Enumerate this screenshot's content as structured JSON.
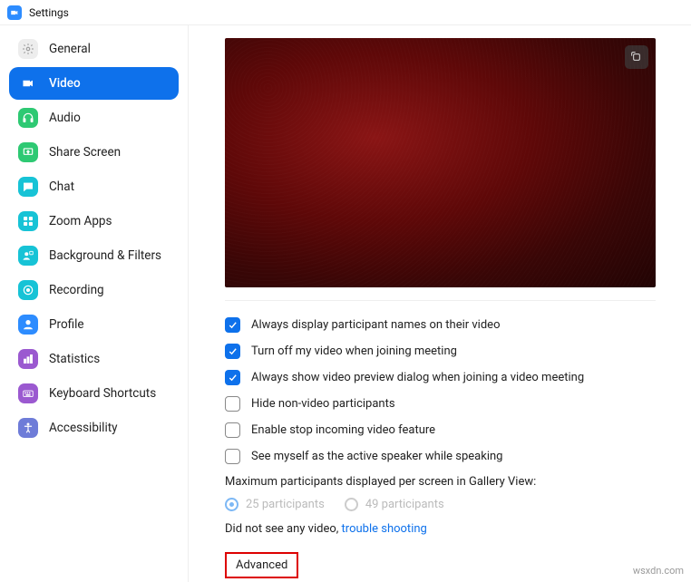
{
  "title": "Settings",
  "sidebar": {
    "items": [
      {
        "label": "General",
        "icon": "gear",
        "bg": "#ededed",
        "fg": "#9e9e9e",
        "active": false
      },
      {
        "label": "Video",
        "icon": "video",
        "bg": "#ffffff",
        "fg": "#ffffff",
        "active": true
      },
      {
        "label": "Audio",
        "icon": "headphones",
        "bg": "#2ec973",
        "fg": "#ffffff",
        "active": false
      },
      {
        "label": "Share Screen",
        "icon": "share",
        "bg": "#2ec973",
        "fg": "#ffffff",
        "active": false
      },
      {
        "label": "Chat",
        "icon": "chat",
        "bg": "#17c3d6",
        "fg": "#ffffff",
        "active": false
      },
      {
        "label": "Zoom Apps",
        "icon": "apps",
        "bg": "#17c3d6",
        "fg": "#ffffff",
        "active": false
      },
      {
        "label": "Background & Filters",
        "icon": "bg",
        "bg": "#17c3d6",
        "fg": "#ffffff",
        "active": false
      },
      {
        "label": "Recording",
        "icon": "record",
        "bg": "#17c3d6",
        "fg": "#ffffff",
        "active": false
      },
      {
        "label": "Profile",
        "icon": "profile",
        "bg": "#2D8CFF",
        "fg": "#ffffff",
        "active": false
      },
      {
        "label": "Statistics",
        "icon": "stats",
        "bg": "#9b59d0",
        "fg": "#ffffff",
        "active": false
      },
      {
        "label": "Keyboard Shortcuts",
        "icon": "keyboard",
        "bg": "#9b59d0",
        "fg": "#ffffff",
        "active": false
      },
      {
        "label": "Accessibility",
        "icon": "accessibility",
        "bg": "#6e7cd8",
        "fg": "#ffffff",
        "active": false
      }
    ]
  },
  "options": [
    {
      "label": "Always display participant names on their video",
      "checked": true
    },
    {
      "label": "Turn off my video when joining meeting",
      "checked": true
    },
    {
      "label": "Always show video preview dialog when joining a video meeting",
      "checked": true
    },
    {
      "label": "Hide non-video participants",
      "checked": false
    },
    {
      "label": "Enable stop incoming video feature",
      "checked": false
    },
    {
      "label": "See myself as the active speaker while speaking",
      "checked": false
    }
  ],
  "gallery": {
    "label": "Maximum participants displayed per screen in Gallery View:",
    "opts": [
      {
        "label": "25 participants",
        "selected": true
      },
      {
        "label": "49 participants",
        "selected": false
      }
    ]
  },
  "help": {
    "prefix": "Did not see any video, ",
    "link": "trouble shooting"
  },
  "advanced": "Advanced",
  "watermark": "wsxdn.com"
}
